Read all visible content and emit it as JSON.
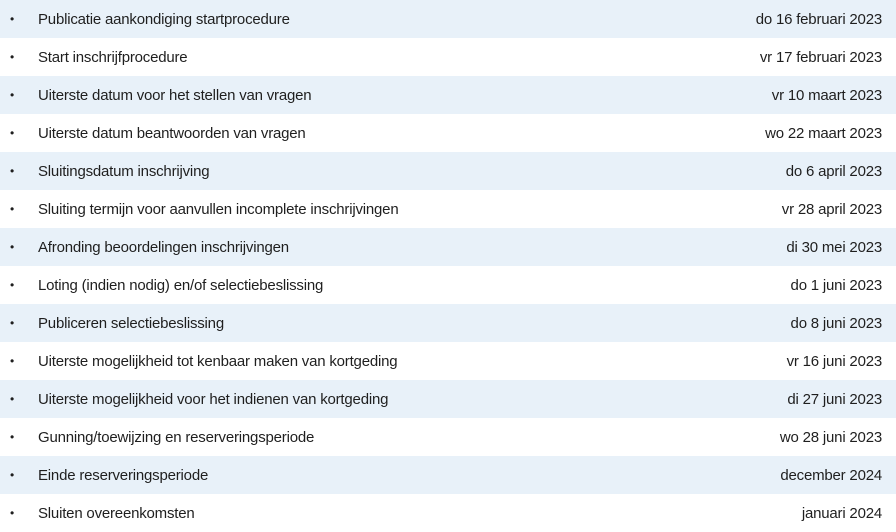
{
  "timeline": {
    "bullet": "•",
    "rows": [
      {
        "label": "Publicatie aankondiging startprocedure",
        "date": "do 16 februari 2023"
      },
      {
        "label": "Start inschrijfprocedure",
        "date": "vr 17 februari 2023"
      },
      {
        "label": "Uiterste datum voor het stellen van vragen",
        "date": "vr 10 maart 2023"
      },
      {
        "label": "Uiterste datum beantwoorden van vragen",
        "date": "wo 22 maart 2023"
      },
      {
        "label": "Sluitingsdatum inschrijving",
        "date": "do 6 april 2023"
      },
      {
        "label": "Sluiting termijn voor aanvullen incomplete inschrijvingen",
        "date": "vr 28 april 2023"
      },
      {
        "label": "Afronding beoordelingen inschrijvingen",
        "date": "di 30 mei 2023"
      },
      {
        "label": "Loting (indien nodig) en/of selectiebeslissing",
        "date": "do 1 juni 2023"
      },
      {
        "label": "Publiceren selectiebeslissing",
        "date": "do 8 juni 2023"
      },
      {
        "label": "Uiterste mogelijkheid tot kenbaar maken van kortgeding",
        "date": "vr 16 juni 2023"
      },
      {
        "label": "Uiterste mogelijkheid voor het indienen van kortgeding",
        "date": "di 27 juni 2023"
      },
      {
        "label": "Gunning/toewijzing en reserveringsperiode",
        "date": "wo 28 juni 2023"
      },
      {
        "label": "Einde reserveringsperiode",
        "date": "december 2024"
      },
      {
        "label": "Sluiten overeenkomsten",
        "date": "januari 2024"
      }
    ]
  }
}
